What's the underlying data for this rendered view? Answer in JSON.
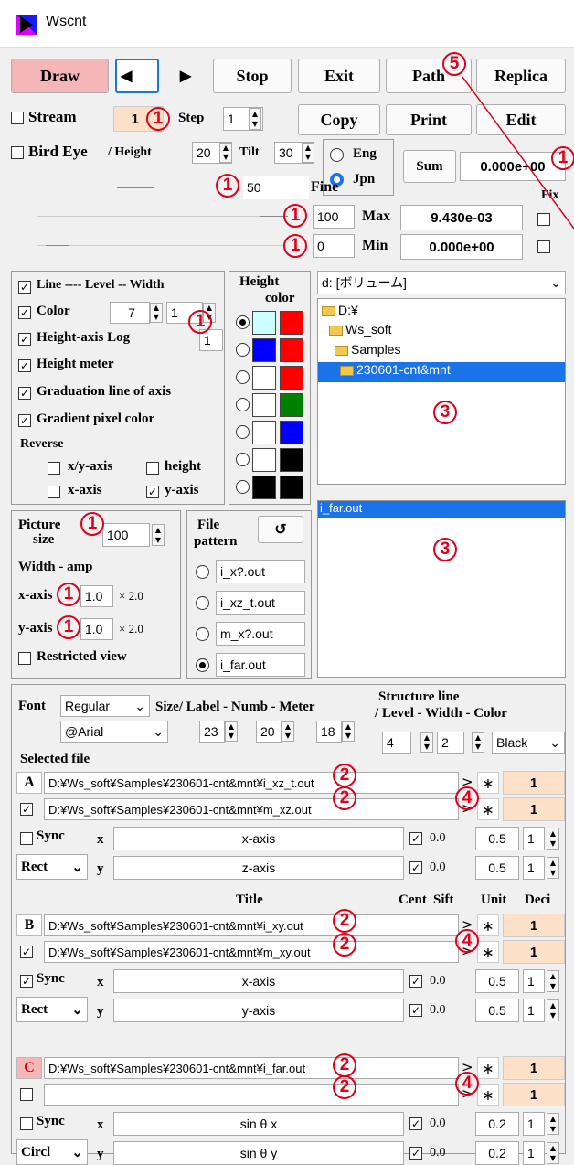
{
  "window": {
    "title": "Wscnt"
  },
  "toolbar": {
    "draw": "Draw",
    "prev": "◀",
    "next": "▶",
    "stop": "Stop",
    "exit": "Exit",
    "path": "Path",
    "replica": "Replica",
    "copy": "Copy",
    "print": "Print",
    "edit": "Edit"
  },
  "stream": {
    "label": "Stream",
    "value": "1",
    "step_label": "Step",
    "step_value": "1"
  },
  "birdeye": {
    "label": "Bird Eye",
    "height_label": "/ Height",
    "height_value": "20",
    "tilt_label": "Tilt",
    "tilt_value": "30"
  },
  "lang": {
    "eng": "Eng",
    "jpn": "Jpn",
    "selected": "Jpn"
  },
  "sum": {
    "label": "Sum",
    "value": "0.000e+00"
  },
  "fine": {
    "value": "50",
    "label": "Fine"
  },
  "max": {
    "value": "100",
    "label": "Max",
    "display": "9.430e-03",
    "fix_label": "Fix"
  },
  "min": {
    "value": "0",
    "label": "Min",
    "display": "0.000e+00"
  },
  "options": {
    "line": "Line ---- Level -- Width",
    "color": "Color",
    "color_level": "7",
    "color_width": "1",
    "log": "Height-axis Log",
    "log_value": "1",
    "meter": "Height meter",
    "grad": "Graduation line of axis",
    "gradient": "Gradient pixel color",
    "reverse": "Reverse",
    "xy_axis": "x/y-axis",
    "height": "height",
    "x_axis": "x-axis",
    "y_axis": "y-axis"
  },
  "height_color": {
    "title1": "Height",
    "title2": "color",
    "swatches": [
      [
        "#ccffff",
        "#ff0000"
      ],
      [
        "#0000ff",
        "#ff0000"
      ],
      [
        "#ffffff",
        "#ff0000"
      ],
      [
        "#ffffff",
        "#008000"
      ],
      [
        "#ffffff",
        "#0000ff"
      ],
      [
        "#ffffff",
        "#000000"
      ],
      [
        "#000000",
        "#000000"
      ]
    ]
  },
  "drive": {
    "value": "d: [ボリューム]"
  },
  "tree": {
    "items": [
      "D:¥",
      "Ws_soft",
      "Samples",
      "230601-cnt&mnt"
    ]
  },
  "files": {
    "items": [
      "i_far.out"
    ]
  },
  "picture": {
    "label1": "Picture",
    "label2": "size",
    "value": "100",
    "amp": "Width - amp",
    "x_label": "x-axis",
    "x_value": "1.0",
    "x_mult": "× 2.0",
    "y_label": "y-axis",
    "y_value": "1.0",
    "y_mult": "× 2.0",
    "restricted": "Restricted view"
  },
  "pattern": {
    "label1": "File",
    "label2": "pattern",
    "refresh": "↺",
    "items": [
      "i_x?.out",
      "i_xz_t.out",
      "m_x?.out",
      "i_far.out"
    ]
  },
  "font": {
    "label": "Font",
    "style": "Regular",
    "face": "@Arial",
    "size_label": "Size/ Label - Numb - Meter",
    "label_size": "23",
    "numb_size": "20",
    "meter_size": "18"
  },
  "structure": {
    "label1": "Structure line",
    "label2": "/ Level - Width - Color",
    "level": "4",
    "width": "2",
    "color": "Black"
  },
  "selected": {
    "label": "Selected file",
    "title": "Title",
    "cent": "Cent",
    "sift": "Sift",
    "unit": "Unit",
    "deci": "Deci"
  },
  "groupA": {
    "letter": "A",
    "file1": "D:¥Ws_soft¥Samples¥230601-cnt&mnt¥i_xz_t.out",
    "file2": "D:¥Ws_soft¥Samples¥230601-cnt&mnt¥m_xz.out",
    "sync": "Sync",
    "shape": "Rect",
    "x": "x",
    "y": "y",
    "x_title": "x-axis",
    "y_title": "z-axis",
    "x_cent": "0.0",
    "x_sift": "0.5",
    "x_unit": "1",
    "y_cent": "0.0",
    "y_sift": "0.5",
    "y_unit": "1",
    "deci1": "1",
    "deci2": "1"
  },
  "groupB": {
    "letter": "B",
    "file1": "D:¥Ws_soft¥Samples¥230601-cnt&mnt¥i_xy.out",
    "file2": "D:¥Ws_soft¥Samples¥230601-cnt&mnt¥m_xy.out",
    "sync": "Sync",
    "shape": "Rect",
    "x": "x",
    "y": "y",
    "x_title": "x-axis",
    "y_title": "y-axis",
    "x_cent": "0.0",
    "x_sift": "0.5",
    "x_unit": "1",
    "y_cent": "0.0",
    "y_sift": "0.5",
    "y_unit": "1",
    "deci1": "1",
    "deci2": "1"
  },
  "groupC": {
    "letter": "C",
    "file1": "D:¥Ws_soft¥Samples¥230601-cnt&mnt¥i_far.out",
    "file2": "",
    "sync": "Sync",
    "shape": "Circl",
    "x": "x",
    "y": "y",
    "x_title": "sin θ x",
    "y_title": "sin θ y",
    "x_cent": "0.0",
    "x_sift": "0.2",
    "x_unit": "1",
    "y_cent": "0.0",
    "y_sift": "0.2",
    "y_unit": "1",
    "deci1": "1",
    "deci2": "1"
  },
  "markers": {
    "m1": "1",
    "m2": "2",
    "m3": "3",
    "m4": "4",
    "m5": "5"
  }
}
